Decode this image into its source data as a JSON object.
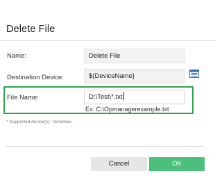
{
  "dialog": {
    "title": "Delete File"
  },
  "form": {
    "name": {
      "label": "Name:",
      "value": "Delete File"
    },
    "destination_device": {
      "label": "Destination Device:",
      "value": "${DeviceName}"
    },
    "file_name": {
      "label": "File Name:",
      "value": "D:\\Test\\*.txt",
      "hint": "Ex: C:\\Opmanagerexample.txt"
    },
    "supported_devices": "* Supported device(s) : Windows"
  },
  "buttons": {
    "cancel": "Cancel",
    "ok": "OK"
  },
  "colors": {
    "highlight": "#2ea44f",
    "ok_button": "#4cbf7c",
    "picker_icon": "#3b6ea8"
  },
  "icons": {
    "device_picker": "device-list-icon"
  }
}
